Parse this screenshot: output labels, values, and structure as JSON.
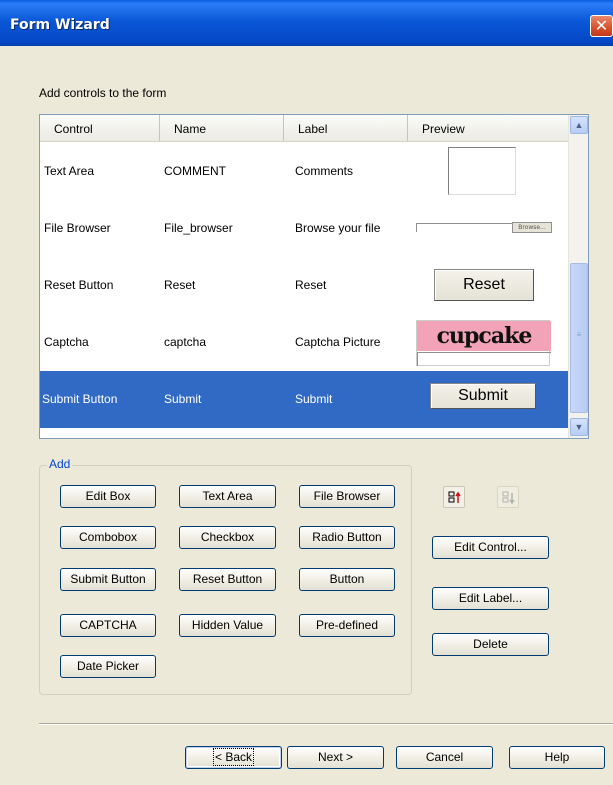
{
  "window": {
    "title": "Form Wizard",
    "close_icon": "close-icon"
  },
  "instruction": "Add controls to the form",
  "grid": {
    "columns": [
      "Control",
      "Name",
      "Label",
      "Preview"
    ],
    "rows": [
      {
        "control": "Text Area",
        "name": "COMMENT",
        "label": "Comments",
        "preview": "textarea"
      },
      {
        "control": "File Browser",
        "name": "File_browser",
        "label": "Browse your file",
        "preview": "file",
        "preview_button": "Browse..."
      },
      {
        "control": "Reset Button",
        "name": "Reset",
        "label": "Reset",
        "preview": "button",
        "preview_text": "Reset"
      },
      {
        "control": "Captcha",
        "name": "captcha",
        "label": "Captcha Picture",
        "preview": "captcha",
        "preview_text": "cupcake"
      },
      {
        "control": "Submit Button",
        "name": "Submit",
        "label": "Submit",
        "preview": "button",
        "preview_text": "Submit",
        "selected": true
      }
    ],
    "scrollbar": {
      "up_icon": "scroll-up-icon",
      "down_icon": "scroll-down-icon",
      "position": 0.8
    }
  },
  "add_group": {
    "label": "Add",
    "buttons": [
      "Edit Box",
      "Text Area",
      "File Browser",
      "Combobox",
      "Checkbox",
      "Radio Button",
      "Submit Button",
      "Reset Button",
      "Button",
      "CAPTCHA",
      "Hidden Value",
      "Pre-defined",
      "Date Picker"
    ]
  },
  "side": {
    "move_up_icon": "move-up-icon",
    "move_down_icon": "move-down-icon",
    "edit_control": "Edit Control...",
    "edit_label": "Edit Label...",
    "delete": "Delete"
  },
  "footer": {
    "back": "< Back",
    "next": "Next >",
    "cancel": "Cancel",
    "help": "Help"
  },
  "colors": {
    "title_bar": "#0b58d8",
    "selection": "#316ac5",
    "group_label": "#0046d5",
    "captcha_bg": "#f3a3b8"
  }
}
